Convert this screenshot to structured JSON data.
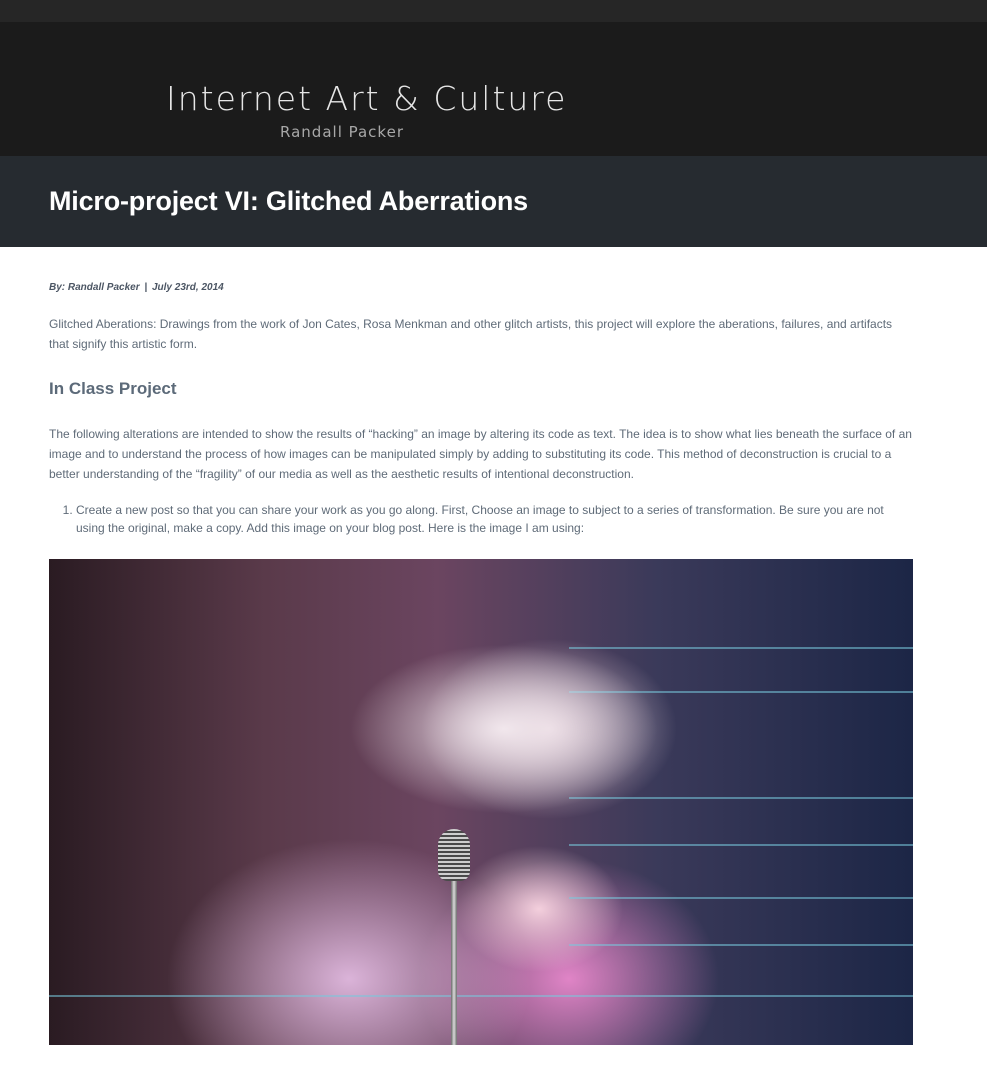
{
  "site": {
    "title": "Internet Art & Culture",
    "subtitle": "Randall Packer"
  },
  "post": {
    "title": "Micro-project VI: Glitched Aberrations",
    "byline_author": "By: Randall Packer",
    "byline_separator": "|",
    "byline_date": "July 23rd, 2014",
    "intro": "Glitched Aberations: Drawings from the work of Jon Cates, Rosa Menkman and other glitch artists, this project will explore the aberations, failures, and artifacts that signify this artistic form.",
    "section_heading": "In Class Project",
    "body": "The following alterations are intended to show the results of “hacking” an image by altering its code as text. The idea is to show what lies beneath the surface of an image and to understand the process of how images can be manipulated simply by adding to substituting its code. This method of deconstruction is crucial to a better understanding of the “fragility” of our media as well as the aesthetic results of intentional deconstruction.",
    "steps": [
      "Create a new post so that you can share your work as you go along. First, Choose an image to subject to a series of transformation. Be sure you are not using the original, make a copy. Add this image on your blog post. Here is the image I am using:"
    ]
  },
  "colors": {
    "masthead": "#1b1b1b",
    "title_bar": "#262b30",
    "body_text": "#5f6b78"
  }
}
